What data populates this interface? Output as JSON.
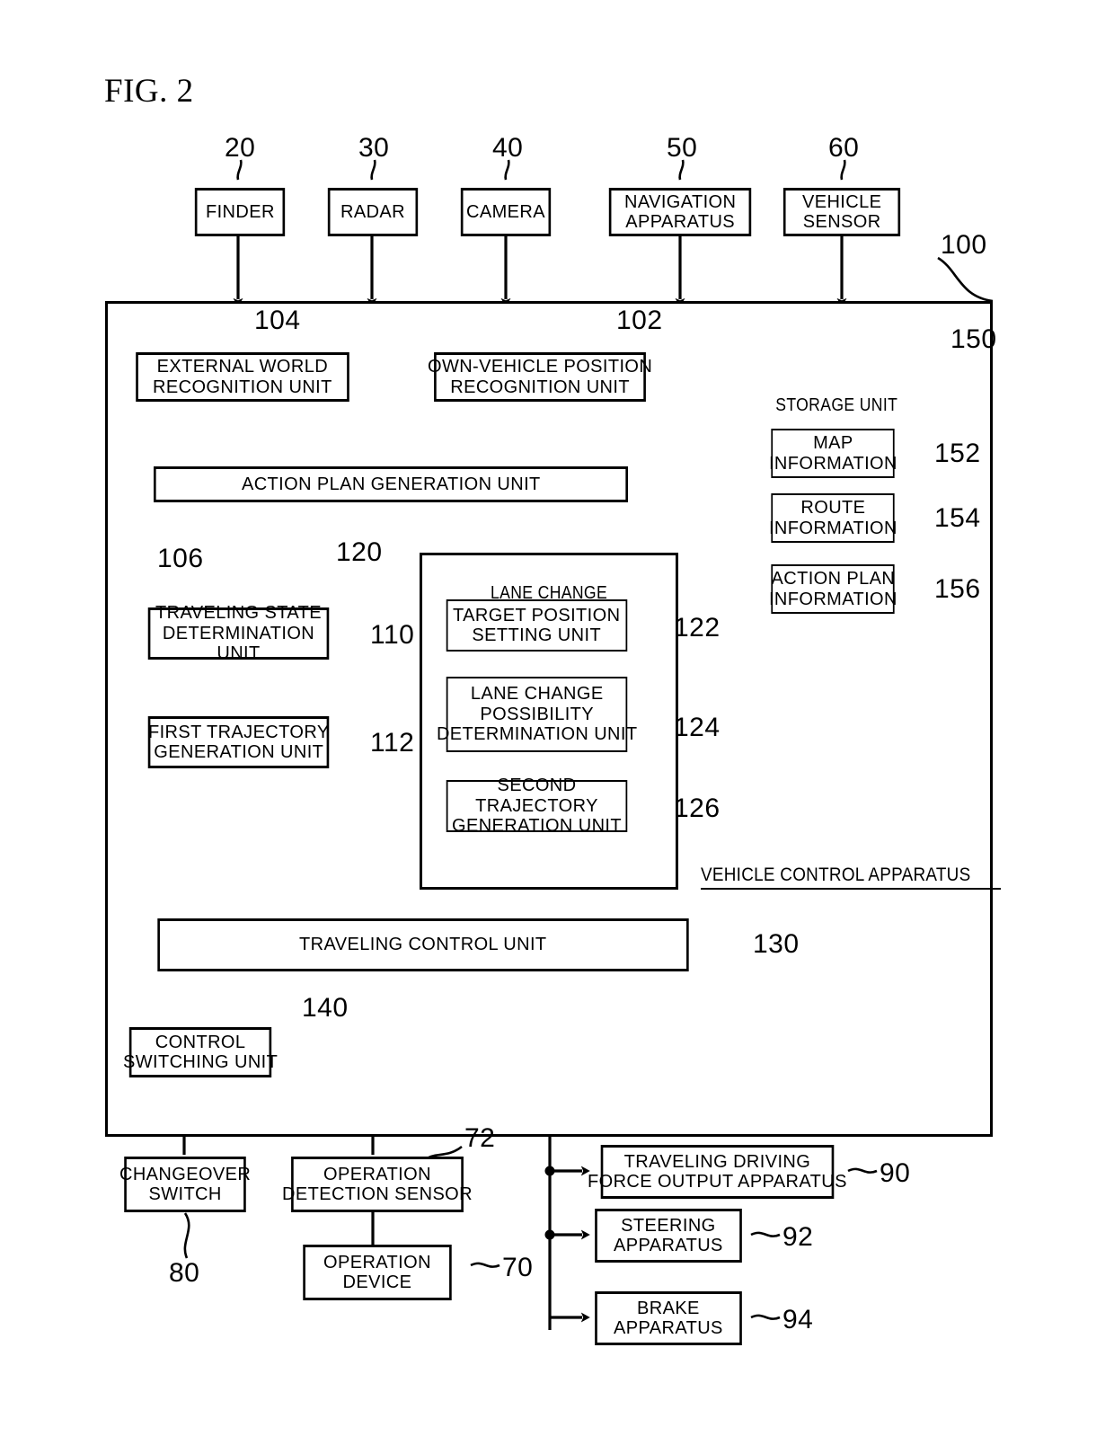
{
  "figure": {
    "title": "FIG. 2",
    "caption": "VEHICLE CONTROL APPARATUS"
  },
  "sensors": [
    {
      "label": "FINDER",
      "ref": "20"
    },
    {
      "label": "RADAR",
      "ref": "30"
    },
    {
      "label": "CAMERA",
      "ref": "40"
    },
    {
      "label": "NAVIGATION\nAPPARATUS",
      "ref": "50"
    },
    {
      "label": "VEHICLE\nSENSOR",
      "ref": "60"
    }
  ],
  "apparatus": {
    "ref": "100",
    "external_world": {
      "label": "EXTERNAL WORLD\nRECOGNITION UNIT",
      "ref": "104"
    },
    "own_vehicle": {
      "label": "OWN-VEHICLE POSITION\nRECOGNITION UNIT",
      "ref": "102"
    },
    "action_plan": {
      "label": "ACTION PLAN GENERATION UNIT",
      "ref": "106"
    },
    "traveling_state": {
      "label": "TRAVELING STATE\nDETERMINATION UNIT",
      "ref": "110"
    },
    "first_trajectory": {
      "label": "FIRST TRAJECTORY\nGENERATION UNIT",
      "ref": "112"
    },
    "traveling_control": {
      "label": "TRAVELING CONTROL UNIT",
      "ref": "130"
    },
    "control_switching": {
      "label": "CONTROL\nSWITCHING UNIT",
      "ref": "140"
    }
  },
  "lane_change": {
    "title": "LANE CHANGE\nCONTROL UNIT",
    "ref": "120",
    "children": [
      {
        "label": "TARGET POSITION\nSETTING UNIT",
        "ref": "122"
      },
      {
        "label": "LANE CHANGE\nPOSSIBILITY\nDETERMINATION UNIT",
        "ref": "124"
      },
      {
        "label": "SECOND TRAJECTORY\nGENERATION UNIT",
        "ref": "126"
      }
    ]
  },
  "storage": {
    "title": "STORAGE UNIT",
    "ref": "150",
    "items": [
      {
        "label": "MAP\nINFORMATION",
        "ref": "152"
      },
      {
        "label": "ROUTE\nINFORMATION",
        "ref": "154"
      },
      {
        "label": "ACTION PLAN\nINFORMATION",
        "ref": "156"
      }
    ]
  },
  "inputs": [
    {
      "label": "CHANGEOVER\nSWITCH",
      "ref": "80"
    },
    {
      "label": "OPERATION\nDETECTION SENSOR",
      "ref": "72"
    },
    {
      "label": "OPERATION\nDEVICE",
      "ref": "70"
    }
  ],
  "outputs": [
    {
      "label": "TRAVELING DRIVING\nFORCE OUTPUT APPARATUS",
      "ref": "90"
    },
    {
      "label": "STEERING\nAPPARATUS",
      "ref": "92"
    },
    {
      "label": "BRAKE\nAPPARATUS",
      "ref": "94"
    }
  ],
  "colors": {
    "line": "#000000",
    "background": "#ffffff"
  }
}
